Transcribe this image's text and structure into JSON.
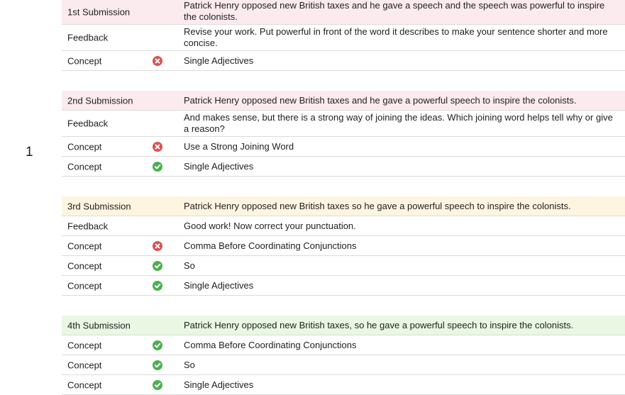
{
  "row_number": "1",
  "groups": [
    {
      "submission": {
        "label": "1st Submission",
        "text": "Patrick Henry opposed new British taxes and he gave a speech and the speech was powerful to inspire the colonists."
      },
      "feedback": {
        "label": "Feedback",
        "text": "Revise your work. Put powerful in front of the word it describes to make your sentence shorter and more concise."
      },
      "concepts": [
        {
          "label": "Concept",
          "status": "incorrect",
          "icon": "x-circle-icon",
          "text": "Single Adjectives"
        }
      ]
    },
    {
      "submission": {
        "label": "2nd Submission",
        "text": "Patrick Henry opposed new British taxes and he gave a powerful speech to inspire the colonists."
      },
      "feedback": {
        "label": "Feedback",
        "text": "And makes sense, but there is a strong way of joining the ideas. Which joining word helps tell why or give a reason?"
      },
      "concepts": [
        {
          "label": "Concept",
          "status": "incorrect",
          "icon": "x-circle-icon",
          "text": "Use a Strong Joining Word"
        },
        {
          "label": "Concept",
          "status": "correct",
          "icon": "check-circle-icon",
          "text": "Single Adjectives"
        }
      ]
    },
    {
      "submission": {
        "label": "3rd Submission",
        "text": "Patrick Henry opposed new British taxes so he gave a powerful speech to inspire the colonists."
      },
      "feedback": {
        "label": "Feedback",
        "text": "Good work! Now correct your punctuation."
      },
      "concepts": [
        {
          "label": "Concept",
          "status": "incorrect",
          "icon": "x-circle-icon",
          "text": "Comma Before Coordinating Conjunctions"
        },
        {
          "label": "Concept",
          "status": "correct",
          "icon": "check-circle-icon",
          "text": "So"
        },
        {
          "label": "Concept",
          "status": "correct",
          "icon": "check-circle-icon",
          "text": "Single Adjectives"
        }
      ]
    },
    {
      "submission": {
        "label": "4th Submission",
        "text": "Patrick Henry opposed new British taxes, so he gave a powerful speech to inspire the colonists."
      },
      "concepts": [
        {
          "label": "Concept",
          "status": "correct",
          "icon": "check-circle-icon",
          "text": "Comma Before Coordinating Conjunctions"
        },
        {
          "label": "Concept",
          "status": "correct",
          "icon": "check-circle-icon",
          "text": "So"
        },
        {
          "label": "Concept",
          "status": "correct",
          "icon": "check-circle-icon",
          "text": "Single Adjectives"
        }
      ]
    }
  ],
  "colors": {
    "incorrect": "#d9534f",
    "correct": "#4caf50",
    "submission_bg_red": "#fcebee",
    "submission_bg_yellow": "#fef5e1",
    "submission_bg_green": "#e9f7e3"
  }
}
